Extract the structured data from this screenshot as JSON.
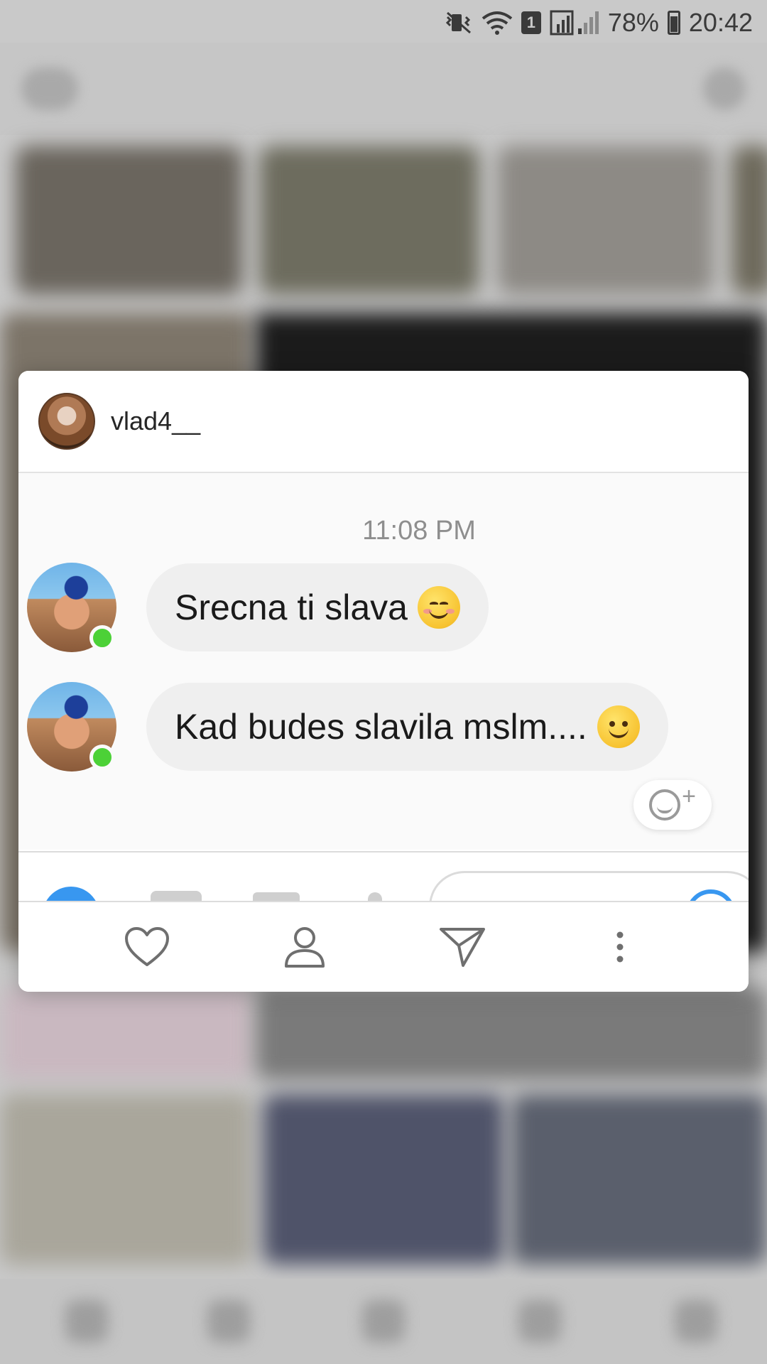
{
  "status_bar": {
    "sim_label": "1",
    "battery": "78%",
    "time": "20:42"
  },
  "dialog": {
    "header": {
      "username": "vlad4__"
    },
    "chat": {
      "timestamp": "11:08 PM",
      "messages": [
        {
          "text": "Srecna ti slava",
          "emoji": "smiling-face-with-smiling-eyes",
          "sender_online": true
        },
        {
          "text": "Kad budes slavila mslm....",
          "emoji": "slightly-smiling-face",
          "sender_online": true
        }
      ]
    },
    "actions": [
      {
        "icon": "heart-icon"
      },
      {
        "icon": "profile-icon"
      },
      {
        "icon": "send-icon"
      },
      {
        "icon": "more-vertical-icon"
      }
    ]
  },
  "colors": {
    "online": "#4cd137",
    "bubble": "#efefef",
    "accent": "#3897f0",
    "timestamp": "#8e8e8e"
  }
}
